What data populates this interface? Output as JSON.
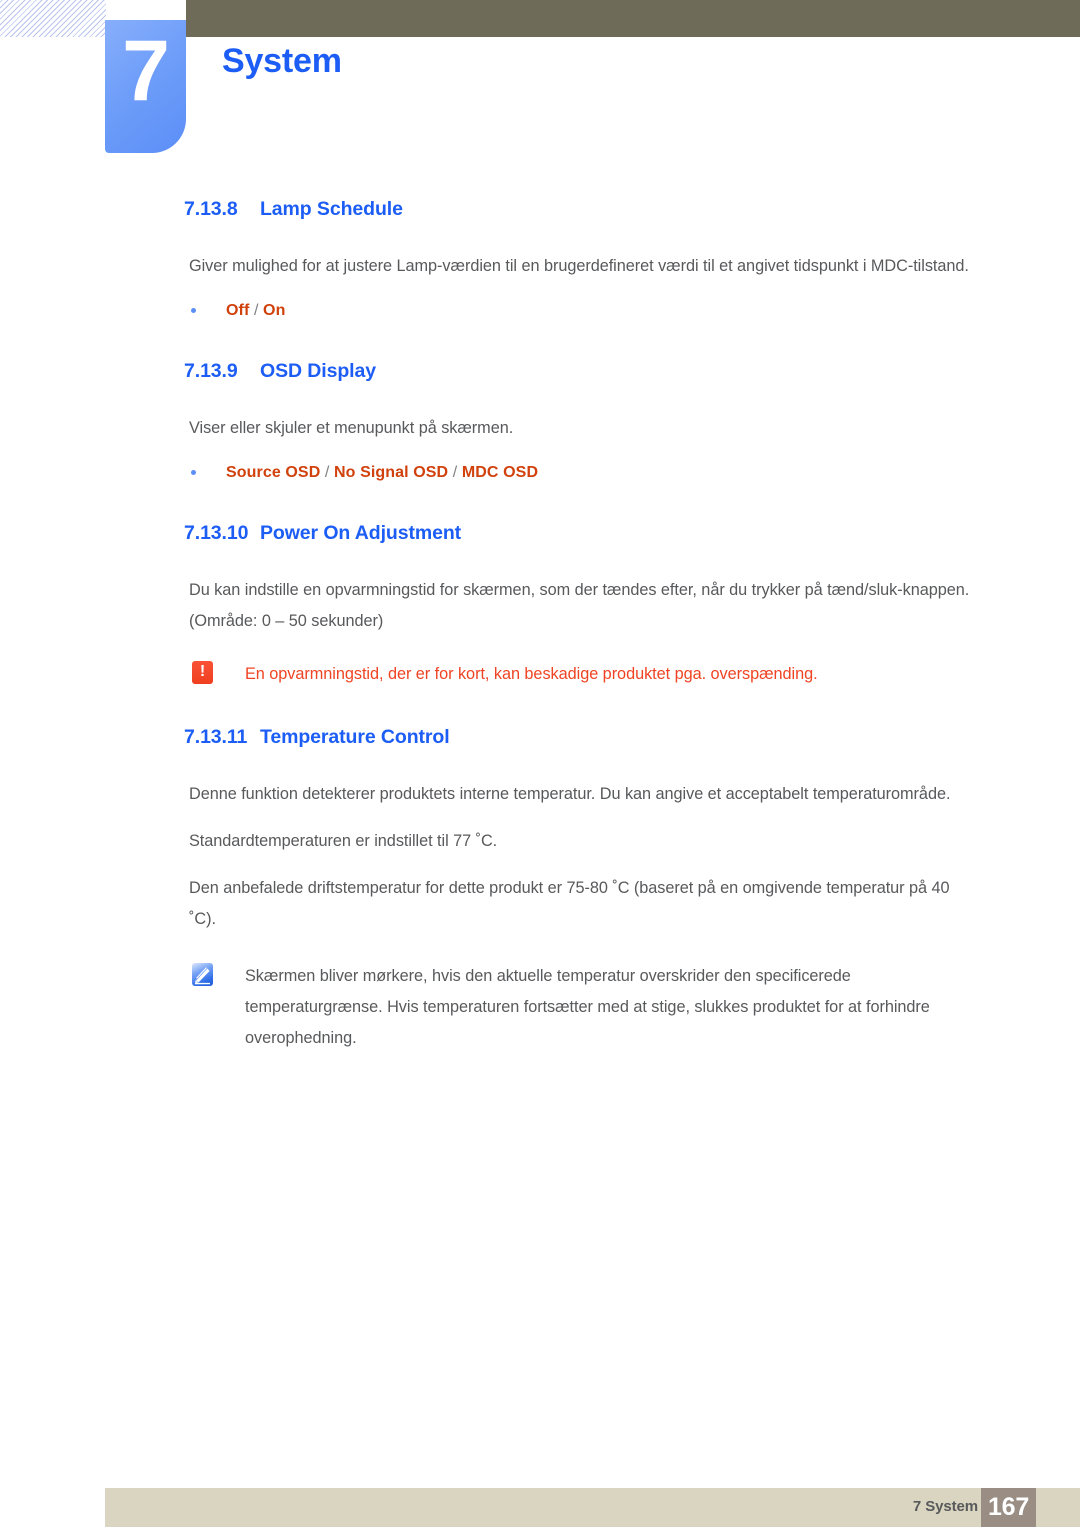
{
  "header": {
    "chapter_number": "7",
    "chapter_title": "System",
    "accent_color": "#1c5df5",
    "bar_color": "#6e6c58"
  },
  "sections": [
    {
      "number": "7.13.8",
      "title": "Lamp Schedule",
      "paragraph": "Giver mulighed for at justere Lamp-værdien til en brugerdefineret værdi til et angivet tidspunkt i MDC-tilstand.",
      "options": [
        "Off",
        "On"
      ]
    },
    {
      "number": "7.13.9",
      "title": "OSD Display",
      "paragraph": "Viser eller skjuler et menupunkt på skærmen.",
      "options": [
        "Source OSD",
        "No Signal OSD",
        "MDC OSD"
      ]
    },
    {
      "number": "7.13.10",
      "title": "Power On Adjustment",
      "paragraph": "Du kan indstille en opvarmningstid for skærmen, som der tændes efter, når du trykker på tænd/sluk-knappen. (Område: 0 – 50 sekunder)",
      "caution": "En opvarmningstid, der er for kort, kan beskadige produktet pga. overspænding."
    },
    {
      "number": "7.13.11",
      "title": "Temperature Control",
      "paragraph_1": "Denne funktion detekterer produktets interne temperatur. Du kan angive et acceptabelt temperaturområde.",
      "paragraph_2": "Standardtemperaturen er indstillet til 77 ˚C.",
      "paragraph_3": "Den anbefalede driftstemperatur for dette produkt er 75-80 ˚C (baseret på en omgivende temperatur på 40 ˚C).",
      "note": "Skærmen bliver mørkere, hvis den aktuelle temperatur overskrider den specificerede temperaturgrænse. Hvis temperaturen fortsætter med at stige, slukkes produktet for at forhindre overophedning."
    }
  ],
  "callouts": {
    "caution_icon_glyph": "!",
    "caution_color": "#ef4423",
    "note_color": "#58595b"
  },
  "separator": "/",
  "footer": {
    "label": "7 System",
    "page_number": "167",
    "band_color": "#d9d5c0",
    "pagenum_color": "#998d84"
  }
}
